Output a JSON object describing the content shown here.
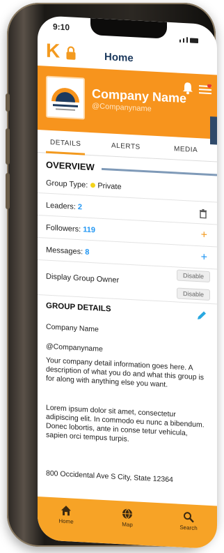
{
  "status_bar": {
    "time": "9:10"
  },
  "nav": {
    "title": "Home"
  },
  "profile": {
    "name": "Company Name",
    "handle": "@Companyname"
  },
  "tabs": [
    {
      "label": "Details"
    },
    {
      "label": "Alerts"
    },
    {
      "label": "Media"
    }
  ],
  "overview": {
    "title": "OVERVIEW",
    "group_type_label": "Group Type:",
    "group_type_value": "Private",
    "leaders_label": "Leaders:",
    "leaders_value": "2",
    "followers_label": "Followers:",
    "followers_value": "119",
    "messages_label": "Messages:",
    "messages_value": "8",
    "display_owner_label": "Display Group Owner",
    "disable_label_1": "Disable",
    "disable_label_2": "Disable"
  },
  "group_details": {
    "title": "GROUP DETAILS",
    "name": "Company Name",
    "handle": "@Companyname",
    "description": "Your company detail information goes here. A description of what you do and what this group is for along with anything else you want.",
    "lorem": "Lorem ipsum dolor sit amet, consectetur adipiscing elit. In commodo eu nunc a bibendum. Donec lobortis, ante in conse tetur vehicula, sapien orci tempus turpis.",
    "address": "800 Occidental Ave S City, State 12364"
  },
  "bottom_nav": [
    {
      "label": "Home",
      "icon": "home-icon"
    },
    {
      "label": "Map",
      "icon": "globe-icon"
    },
    {
      "label": "Search",
      "icon": "search-icon"
    }
  ],
  "colors": {
    "brand_orange": "#f7941d",
    "link_blue": "#2196f3",
    "navy": "#1d3a5e"
  }
}
